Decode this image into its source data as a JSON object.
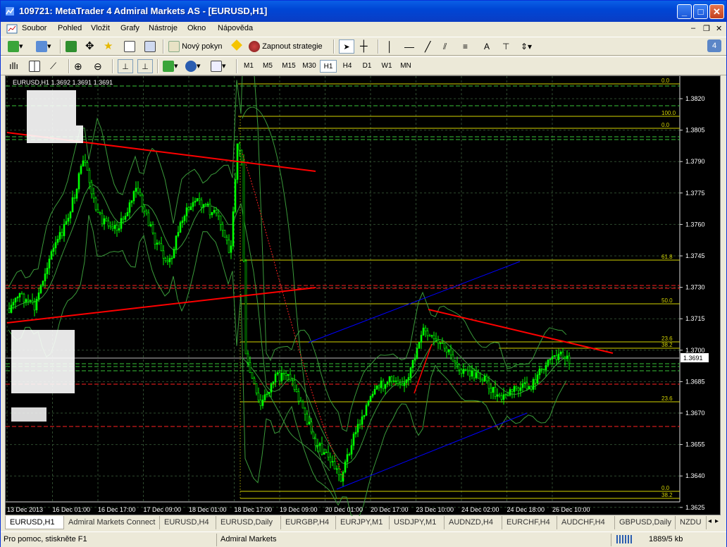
{
  "window": {
    "title": "109721: MetaTrader 4 Admiral Markets AS - [EURUSD,H1]"
  },
  "menu": [
    "Soubor",
    "Pohled",
    "Vložit",
    "Grafy",
    "Nástroje",
    "Okno",
    "Nápověda"
  ],
  "toolbar": {
    "new_order": "Nový pokyn",
    "start_strategy": "Zapnout strategie",
    "text_tool": "A",
    "timeframes": [
      "M1",
      "M5",
      "M15",
      "M30",
      "H1",
      "H4",
      "D1",
      "W1",
      "MN"
    ],
    "active_timeframe": "H1"
  },
  "chart": {
    "header": "EURUSD,H1  1.3692 1.3691 1.3691",
    "price_axis": [
      "1.3820",
      "1.3805",
      "1.3790",
      "1.3775",
      "1.3760",
      "1.3745",
      "1.3730",
      "1.3715",
      "1.3700",
      "1.3685",
      "1.3670",
      "1.3655",
      "1.3640",
      "1.3625"
    ],
    "current_price": "1.3691",
    "fib_labels": [
      "0.0",
      "100.0",
      "0.0",
      "61.8",
      "50.0",
      "23.6",
      "38.2",
      "23.6",
      "0.0",
      "38.2"
    ],
    "time_axis": [
      "13 Dec 2013",
      "16 Dec 01:00",
      "16 Dec 17:00",
      "17 Dec 09:00",
      "18 Dec 01:00",
      "18 Dec 17:00",
      "19 Dec 09:00",
      "20 Dec 01:00",
      "20 Dec 17:00",
      "23 Dec 10:00",
      "24 Dec 02:00",
      "24 Dec 18:00",
      "26 Dec 10:00"
    ],
    "colors": {
      "background": "#000000",
      "candles": "#00ff00",
      "grid": "#2e4a2e",
      "trendline_red": "#ff0000",
      "channel_blue": "#0000ff",
      "fib": "#d4d400",
      "bands": "#3a9a3a"
    }
  },
  "tabs": [
    "EURUSD,H1",
    "Admiral Markets Connect",
    "EURUSD,H4",
    "EURUSD,Daily",
    "EURGBP,H4",
    "EURJPY,M1",
    "USDJPY,M1",
    "AUDNZD,H4",
    "EURCHF,H4",
    "AUDCHF,H4",
    "GBPUSD,Daily",
    "NZDU"
  ],
  "status": {
    "help": "Pro pomoc, stiskněte F1",
    "server": "Admiral Markets",
    "traffic": "1889/5 kb"
  }
}
